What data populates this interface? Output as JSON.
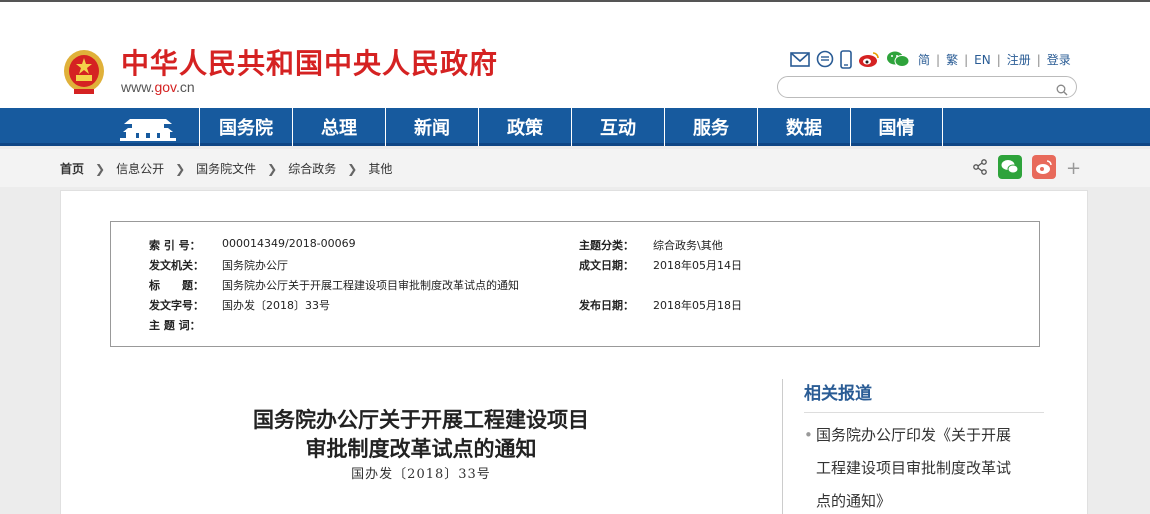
{
  "header": {
    "site_title": "中华人民共和国中央人民政府",
    "site_url_prefix": "www.",
    "site_url_brand": "gov",
    "site_url_suffix": ".cn",
    "icons": [
      "mail-icon",
      "message-icon",
      "mobile-icon",
      "weibo-icon",
      "wechat-icon"
    ],
    "lang_links": [
      "简",
      "繁",
      "EN",
      "注册",
      "登录"
    ],
    "search": {
      "placeholder": "",
      "value": ""
    }
  },
  "nav": {
    "items": [
      "国务院",
      "总理",
      "新闻",
      "政策",
      "互动",
      "服务",
      "数据",
      "国情"
    ]
  },
  "breadcrumb": {
    "items": [
      "首页",
      "信息公开",
      "国务院文件",
      "综合政务",
      "其他"
    ]
  },
  "share": {
    "icons": [
      "share-icon",
      "wechat-share-icon",
      "weibo-share-icon",
      "more-icon"
    ],
    "more_label": "+"
  },
  "info": {
    "index_label": "索 引 号：",
    "index_value": "000014349/2018-00069",
    "topic_label": "主题分类：",
    "topic_value": "综合政务\\其他",
    "issuer_label": "发文机关：",
    "issuer_value": "国务院办公厅",
    "written_label": "成文日期：",
    "written_value": "2018年05月14日",
    "title_label": "标　　题：",
    "title_value": "国务院办公厅关于开展工程建设项目审批制度改革试点的通知",
    "docno_label": "发文字号：",
    "docno_value": "国办发〔2018〕33号",
    "publish_label": "发布日期：",
    "publish_value": "2018年05月18日",
    "keywords_label": "主 题 词：",
    "keywords_value": ""
  },
  "document": {
    "title_line1": "国务院办公厅关于开展工程建设项目",
    "title_line2": "审批制度改革试点的通知",
    "number": "国办发〔2018〕33号"
  },
  "related": {
    "title": "相关报道",
    "items": [
      {
        "bullet": "•",
        "line1": "国务院办公厅印发《关于开展",
        "line2": "工程建设项目审批制度改革试",
        "line3": "点的通知》"
      }
    ]
  },
  "colors": {
    "brand_red": "#d52222",
    "nav_blue": "#175a9e",
    "link_blue": "#2a5c95"
  }
}
